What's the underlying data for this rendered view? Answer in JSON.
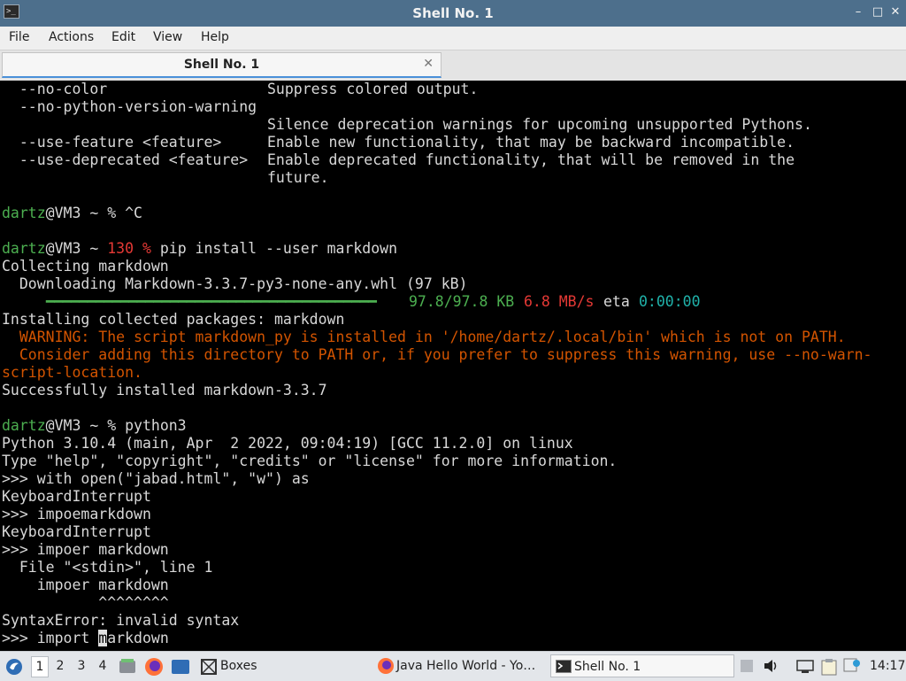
{
  "window": {
    "title": "Shell No. 1",
    "controls": [
      "–",
      "□",
      "✕"
    ]
  },
  "menu": {
    "items": [
      "File",
      "Actions",
      "Edit",
      "View",
      "Help"
    ]
  },
  "tabs": [
    {
      "label": "Shell No. 1",
      "close": "✕"
    }
  ],
  "terminal": {
    "lines": {
      "l1_opt": "  --no-color",
      "l1_desc": "Suppress colored output.",
      "l2_opt": "  --no-python-version-warning",
      "l3_desc": "Silence deprecation warnings for upcoming unsupported Pythons.",
      "l4_opt": "  --use-feature <feature>",
      "l4_desc": "Enable new functionality, that may be backward incompatible.",
      "l5_opt": "  --use-deprecated <feature>",
      "l5_desc": "Enable deprecated functionality, that will be removed in the",
      "l6_desc": "future.",
      "p1_user": "dartz",
      "p1_host": "@VM3 ~ % ",
      "p1_cmd": "^C",
      "p2_user": "dartz",
      "p2_host": "@VM3 ~ ",
      "p2_code": "130 %",
      "p2_cmd": " pip install --user markdown",
      "collect": "Collecting markdown",
      "download": "  Downloading Markdown-3.3.7-py3-none-any.whl (97 kB)",
      "progress_bar": "━━━━━━━━━━━━━━━━━━━━━━━━━━━━━━━━━━━━━━━━",
      "progress_size": "97.8/97.8 KB",
      "progress_speed": "6.8 MB/s",
      "progress_eta_label": "eta",
      "progress_eta": "0:00:00",
      "installing": "Installing collected packages: markdown",
      "warn1": "  WARNING: The script markdown_py is installed in '/home/dartz/.local/bin' which is not on PATH.",
      "warn2": "  Consider adding this directory to PATH or, if you prefer to suppress this warning, use --no-warn-",
      "warn3": "script-location.",
      "success": "Successfully installed markdown-3.3.7",
      "p3_user": "dartz",
      "p3_host": "@VM3 ~ % ",
      "p3_cmd": "python3",
      "py1": "Python 3.10.4 (main, Apr  2 2022, 09:04:19) [GCC 11.2.0] on linux",
      "py2": "Type \"help\", \"copyright\", \"credits\" or \"license\" for more information.",
      "py3": ">>> with open(\"jabad.html\", \"w\") as",
      "py4": "KeyboardInterrupt",
      "py5": ">>> impoemarkdown",
      "py6": "KeyboardInterrupt",
      "py7": ">>> impoer markdown",
      "py8": "  File \"<stdin>\", line 1",
      "py9": "    impoer markdown",
      "py10": "           ^^^^^^^^",
      "py11": "SyntaxError: invalid syntax",
      "py12_pre": ">>> import ",
      "py12_cursor": "m",
      "py12_post": "arkdown"
    }
  },
  "taskbar": {
    "workspaces": [
      "1",
      "2",
      "3",
      "4"
    ],
    "active_workspace": "1",
    "boxes_label": "Boxes",
    "tasks": [
      {
        "label": "Java Hello World - Yo…"
      },
      {
        "label": "Shell No. 1"
      }
    ],
    "clock": "14:17"
  },
  "colors": {
    "titlebar": "#4d6f8c",
    "prompt_user": "#4caf50",
    "error_code": "#e53935",
    "warning": "#d35400",
    "eta": "#20b2aa"
  }
}
